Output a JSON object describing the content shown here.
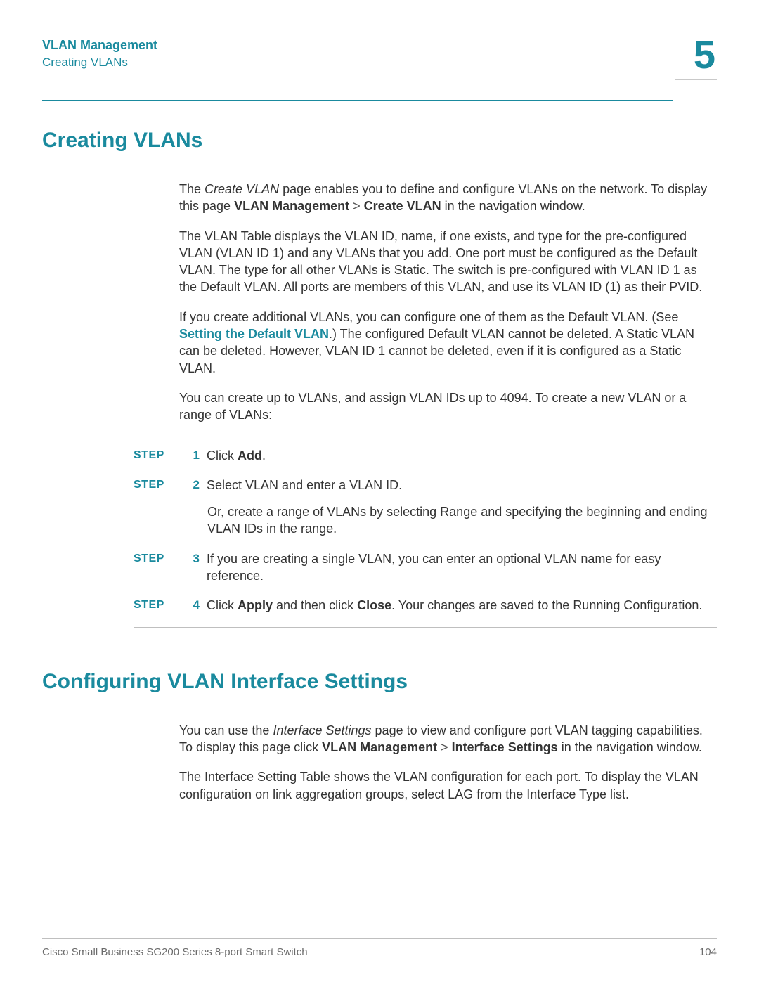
{
  "header": {
    "title": "VLAN Management",
    "subtitle": "Creating VLANs",
    "chapter_number": "5"
  },
  "section1": {
    "heading": "Creating VLANs",
    "p1_a": "The ",
    "p1_b": "Create VLAN",
    "p1_c": " page enables you to define and configure VLANs on the network. To display this page ",
    "p1_d": "VLAN Management",
    "p1_gt": " > ",
    "p1_e": "Create VLAN",
    "p1_f": " in the navigation window.",
    "p2": "The VLAN Table displays the VLAN ID, name, if one exists, and type for the pre-configured VLAN (VLAN ID 1) and any VLANs that you add. One port must be configured as the Default VLAN. The type for all other VLANs is Static. The switch is pre-configured with VLAN ID 1 as the Default VLAN. All ports are members of this VLAN, and use its VLAN ID (1) as their PVID.",
    "p3_a": "If you create additional VLANs, you can configure one of them as the Default VLAN. (See ",
    "p3_link": "Setting the Default VLAN",
    "p3_b": ".) The configured Default VLAN cannot be deleted. A Static VLAN can be deleted. However, VLAN ID 1 cannot be deleted, even if it is configured as a Static VLAN.",
    "p4": "You can create up to  VLANs, and assign VLAN IDs up to 4094. To create a new VLAN or a range of VLANs:"
  },
  "steps": [
    {
      "label": "STEP",
      "num": "1",
      "text_a": "Click ",
      "bold_a": "Add",
      "text_b": "."
    },
    {
      "label": "STEP",
      "num": "2",
      "text_a": "Select VLAN and enter a VLAN ID.",
      "continue": "Or, create a range of VLANs by selecting Range and specifying the beginning and ending VLAN IDs in the range."
    },
    {
      "label": "STEP",
      "num": "3",
      "text_a": "If you are creating a single VLAN, you can enter an optional VLAN name for easy reference."
    },
    {
      "label": "STEP",
      "num": "4",
      "text_a": "Click ",
      "bold_a": "Apply",
      "text_b": " and then click ",
      "bold_b": "Close",
      "text_c": ". Your changes are saved to the Running Configuration."
    }
  ],
  "section2": {
    "heading": "Configuring VLAN Interface Settings",
    "p1_a": "You can use the ",
    "p1_b": "Interface Settings",
    "p1_c": " page to view and configure port VLAN tagging capabilities. To display this page click ",
    "p1_d": "VLAN Management",
    "p1_gt": " > ",
    "p1_e": "Interface Settings",
    "p1_f": " in the navigation window.",
    "p2": "The Interface Setting Table shows the VLAN configuration for each port. To display the VLAN configuration on link aggregation groups, select LAG from the Interface Type list."
  },
  "footer": {
    "left": "Cisco Small Business SG200 Series 8-port Smart Switch",
    "page": "104"
  }
}
